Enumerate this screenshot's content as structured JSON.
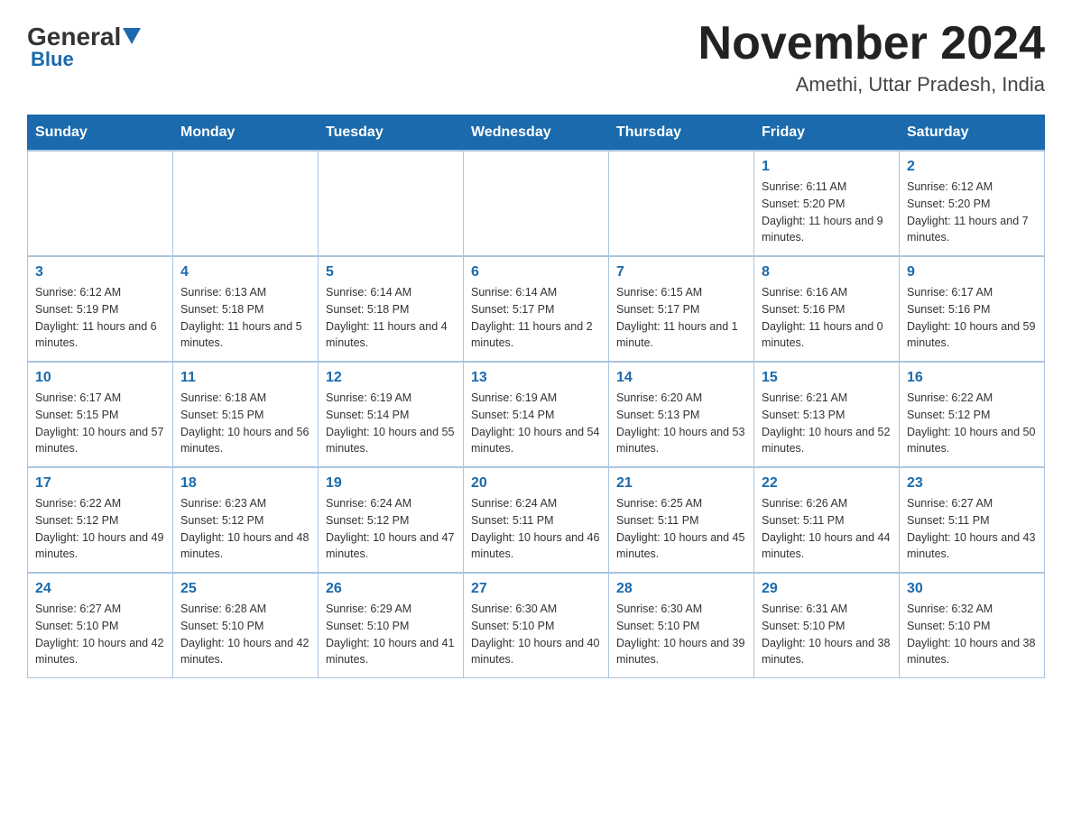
{
  "header": {
    "logo": {
      "general": "General",
      "blue": "Blue"
    },
    "title": "November 2024",
    "location": "Amethi, Uttar Pradesh, India"
  },
  "days_of_week": [
    "Sunday",
    "Monday",
    "Tuesday",
    "Wednesday",
    "Thursday",
    "Friday",
    "Saturday"
  ],
  "weeks": [
    [
      {
        "day": "",
        "sunrise": "",
        "sunset": "",
        "daylight": ""
      },
      {
        "day": "",
        "sunrise": "",
        "sunset": "",
        "daylight": ""
      },
      {
        "day": "",
        "sunrise": "",
        "sunset": "",
        "daylight": ""
      },
      {
        "day": "",
        "sunrise": "",
        "sunset": "",
        "daylight": ""
      },
      {
        "day": "",
        "sunrise": "",
        "sunset": "",
        "daylight": ""
      },
      {
        "day": "1",
        "sunrise": "Sunrise: 6:11 AM",
        "sunset": "Sunset: 5:20 PM",
        "daylight": "Daylight: 11 hours and 9 minutes."
      },
      {
        "day": "2",
        "sunrise": "Sunrise: 6:12 AM",
        "sunset": "Sunset: 5:20 PM",
        "daylight": "Daylight: 11 hours and 7 minutes."
      }
    ],
    [
      {
        "day": "3",
        "sunrise": "Sunrise: 6:12 AM",
        "sunset": "Sunset: 5:19 PM",
        "daylight": "Daylight: 11 hours and 6 minutes."
      },
      {
        "day": "4",
        "sunrise": "Sunrise: 6:13 AM",
        "sunset": "Sunset: 5:18 PM",
        "daylight": "Daylight: 11 hours and 5 minutes."
      },
      {
        "day": "5",
        "sunrise": "Sunrise: 6:14 AM",
        "sunset": "Sunset: 5:18 PM",
        "daylight": "Daylight: 11 hours and 4 minutes."
      },
      {
        "day": "6",
        "sunrise": "Sunrise: 6:14 AM",
        "sunset": "Sunset: 5:17 PM",
        "daylight": "Daylight: 11 hours and 2 minutes."
      },
      {
        "day": "7",
        "sunrise": "Sunrise: 6:15 AM",
        "sunset": "Sunset: 5:17 PM",
        "daylight": "Daylight: 11 hours and 1 minute."
      },
      {
        "day": "8",
        "sunrise": "Sunrise: 6:16 AM",
        "sunset": "Sunset: 5:16 PM",
        "daylight": "Daylight: 11 hours and 0 minutes."
      },
      {
        "day": "9",
        "sunrise": "Sunrise: 6:17 AM",
        "sunset": "Sunset: 5:16 PM",
        "daylight": "Daylight: 10 hours and 59 minutes."
      }
    ],
    [
      {
        "day": "10",
        "sunrise": "Sunrise: 6:17 AM",
        "sunset": "Sunset: 5:15 PM",
        "daylight": "Daylight: 10 hours and 57 minutes."
      },
      {
        "day": "11",
        "sunrise": "Sunrise: 6:18 AM",
        "sunset": "Sunset: 5:15 PM",
        "daylight": "Daylight: 10 hours and 56 minutes."
      },
      {
        "day": "12",
        "sunrise": "Sunrise: 6:19 AM",
        "sunset": "Sunset: 5:14 PM",
        "daylight": "Daylight: 10 hours and 55 minutes."
      },
      {
        "day": "13",
        "sunrise": "Sunrise: 6:19 AM",
        "sunset": "Sunset: 5:14 PM",
        "daylight": "Daylight: 10 hours and 54 minutes."
      },
      {
        "day": "14",
        "sunrise": "Sunrise: 6:20 AM",
        "sunset": "Sunset: 5:13 PM",
        "daylight": "Daylight: 10 hours and 53 minutes."
      },
      {
        "day": "15",
        "sunrise": "Sunrise: 6:21 AM",
        "sunset": "Sunset: 5:13 PM",
        "daylight": "Daylight: 10 hours and 52 minutes."
      },
      {
        "day": "16",
        "sunrise": "Sunrise: 6:22 AM",
        "sunset": "Sunset: 5:12 PM",
        "daylight": "Daylight: 10 hours and 50 minutes."
      }
    ],
    [
      {
        "day": "17",
        "sunrise": "Sunrise: 6:22 AM",
        "sunset": "Sunset: 5:12 PM",
        "daylight": "Daylight: 10 hours and 49 minutes."
      },
      {
        "day": "18",
        "sunrise": "Sunrise: 6:23 AM",
        "sunset": "Sunset: 5:12 PM",
        "daylight": "Daylight: 10 hours and 48 minutes."
      },
      {
        "day": "19",
        "sunrise": "Sunrise: 6:24 AM",
        "sunset": "Sunset: 5:12 PM",
        "daylight": "Daylight: 10 hours and 47 minutes."
      },
      {
        "day": "20",
        "sunrise": "Sunrise: 6:24 AM",
        "sunset": "Sunset: 5:11 PM",
        "daylight": "Daylight: 10 hours and 46 minutes."
      },
      {
        "day": "21",
        "sunrise": "Sunrise: 6:25 AM",
        "sunset": "Sunset: 5:11 PM",
        "daylight": "Daylight: 10 hours and 45 minutes."
      },
      {
        "day": "22",
        "sunrise": "Sunrise: 6:26 AM",
        "sunset": "Sunset: 5:11 PM",
        "daylight": "Daylight: 10 hours and 44 minutes."
      },
      {
        "day": "23",
        "sunrise": "Sunrise: 6:27 AM",
        "sunset": "Sunset: 5:11 PM",
        "daylight": "Daylight: 10 hours and 43 minutes."
      }
    ],
    [
      {
        "day": "24",
        "sunrise": "Sunrise: 6:27 AM",
        "sunset": "Sunset: 5:10 PM",
        "daylight": "Daylight: 10 hours and 42 minutes."
      },
      {
        "day": "25",
        "sunrise": "Sunrise: 6:28 AM",
        "sunset": "Sunset: 5:10 PM",
        "daylight": "Daylight: 10 hours and 42 minutes."
      },
      {
        "day": "26",
        "sunrise": "Sunrise: 6:29 AM",
        "sunset": "Sunset: 5:10 PM",
        "daylight": "Daylight: 10 hours and 41 minutes."
      },
      {
        "day": "27",
        "sunrise": "Sunrise: 6:30 AM",
        "sunset": "Sunset: 5:10 PM",
        "daylight": "Daylight: 10 hours and 40 minutes."
      },
      {
        "day": "28",
        "sunrise": "Sunrise: 6:30 AM",
        "sunset": "Sunset: 5:10 PM",
        "daylight": "Daylight: 10 hours and 39 minutes."
      },
      {
        "day": "29",
        "sunrise": "Sunrise: 6:31 AM",
        "sunset": "Sunset: 5:10 PM",
        "daylight": "Daylight: 10 hours and 38 minutes."
      },
      {
        "day": "30",
        "sunrise": "Sunrise: 6:32 AM",
        "sunset": "Sunset: 5:10 PM",
        "daylight": "Daylight: 10 hours and 38 minutes."
      }
    ]
  ]
}
